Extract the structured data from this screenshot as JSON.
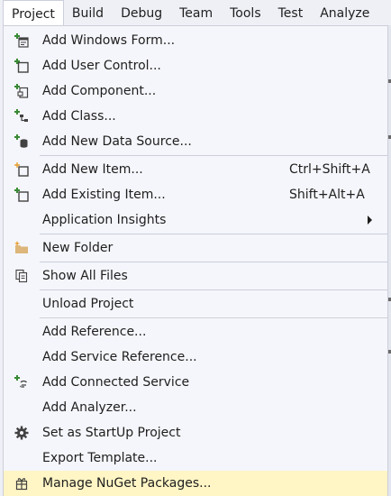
{
  "menubar": {
    "items": [
      {
        "label": "Project"
      },
      {
        "label": "Build"
      },
      {
        "label": "Debug"
      },
      {
        "label": "Team"
      },
      {
        "label": "Tools"
      },
      {
        "label": "Test"
      },
      {
        "label": "Analyze"
      }
    ]
  },
  "menu": {
    "add_windows_form": {
      "label": "Add Windows Form...",
      "icon": "add-windows-form-icon"
    },
    "add_user_control": {
      "label": "Add User Control...",
      "icon": "add-user-control-icon"
    },
    "add_component": {
      "label": "Add Component...",
      "icon": "add-component-icon"
    },
    "add_class": {
      "label": "Add Class...",
      "icon": "add-class-icon"
    },
    "add_new_data_source": {
      "label": "Add New Data Source...",
      "icon": "add-data-source-icon"
    },
    "add_new_item": {
      "label": "Add New Item...",
      "shortcut": "Ctrl+Shift+A",
      "icon": "add-new-item-icon"
    },
    "add_existing_item": {
      "label": "Add Existing Item...",
      "shortcut": "Shift+Alt+A",
      "icon": "add-existing-item-icon"
    },
    "application_insights": {
      "label": "Application Insights"
    },
    "new_folder": {
      "label": "New Folder",
      "icon": "new-folder-icon"
    },
    "show_all_files": {
      "label": "Show All Files",
      "icon": "show-all-files-icon"
    },
    "unload_project": {
      "label": "Unload Project"
    },
    "add_reference": {
      "label": "Add Reference..."
    },
    "add_service_reference": {
      "label": "Add Service Reference..."
    },
    "add_connected_service": {
      "label": "Add Connected Service",
      "icon": "connected-service-icon"
    },
    "add_analyzer": {
      "label": "Add Analyzer..."
    },
    "set_startup": {
      "label": "Set as StartUp Project",
      "icon": "gear-icon"
    },
    "export_template": {
      "label": "Export Template..."
    },
    "manage_nuget": {
      "label": "Manage NuGet Packages...",
      "icon": "nuget-icon"
    }
  },
  "colors": {
    "menu_bg": "#f5f6fb",
    "highlight": "#fff5c5",
    "separator": "#cccedb",
    "icon_green": "#388a34",
    "icon_dark": "#424242",
    "icon_orange": "#e8a33b"
  }
}
